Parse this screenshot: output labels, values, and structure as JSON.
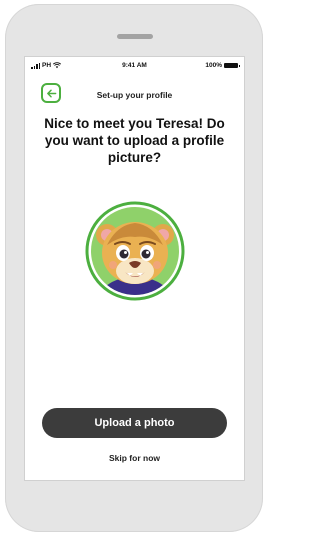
{
  "status_bar": {
    "carrier": "PH",
    "time": "9:41 AM",
    "battery": "100%"
  },
  "header": {
    "title": "Set-up your profile",
    "back_icon": "arrow-left-icon"
  },
  "heading": "Nice to meet you Teresa! Do you want to upload a profile picture?",
  "avatar": {
    "icon": "lion-cub-avatar",
    "ring_color": "#4caf3f"
  },
  "actions": {
    "upload_label": "Upload a photo",
    "skip_label": "Skip for now"
  },
  "colors": {
    "accent": "#4caf3f",
    "button": "#3c3c3c"
  }
}
